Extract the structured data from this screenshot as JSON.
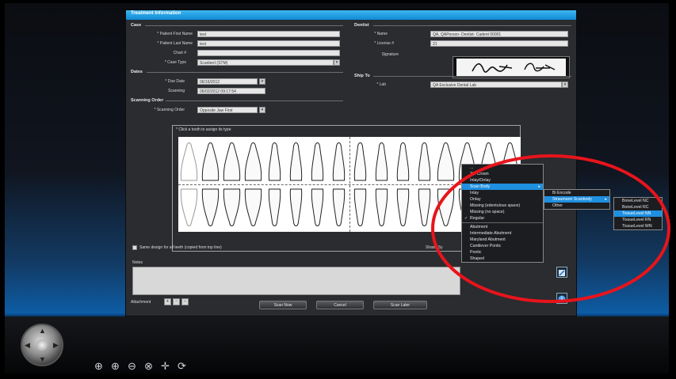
{
  "window": {
    "title": "Treatment Information"
  },
  "case": {
    "section": "Case",
    "first_name_label": "* Patient First Name",
    "first_name_value": "test",
    "last_name_label": "* Patient Last Name",
    "last_name_value": "test",
    "chart_label": "Chart #",
    "chart_value": "",
    "case_type_label": "* Case Type",
    "case_type_value": "Scanbert (STM)"
  },
  "dates": {
    "section": "Dates",
    "due_label": "* Due Date",
    "due_value": "06/16/2012",
    "scanning_label": "Scanning",
    "scanning_value": "06/02/2012 09:17:54"
  },
  "scanning_order": {
    "section": "Scanning Order",
    "label": "* Scanning Order",
    "value": "Opposite Jaw First"
  },
  "dentist": {
    "section": "Dentist",
    "name_label": "* Name",
    "name_value": "QA, QAPerson- Dentist- Cadent 00001",
    "license_label": "* License #",
    "license_value": "21",
    "signature_label": "Signature"
  },
  "ship_to": {
    "section": "Ship To",
    "lab_label": "* Lab",
    "lab_value": "QA Exclusive Dental Lab"
  },
  "teeth": {
    "hint": "* Click a tooth to assign its type",
    "same_design_label": "Same design for all teeth (copied from top line)",
    "shade_label": "Shade Sy"
  },
  "notes": {
    "label": "Notes"
  },
  "attachments": {
    "label": "Attachment"
  },
  "buttons": {
    "scan_now": "Scan Now",
    "cancel": "Cancel",
    "scan_later": "Scan Later"
  },
  "context_menu": {
    "items": [
      "...",
      "3/4 Crown",
      "Inlay/Onlay",
      "Scan Body",
      "Inlay",
      "Onlay",
      "Missing (edentulous space)",
      "Missing (no space)",
      "Regular",
      "Abutment",
      "Intermediate Abutment",
      "Maryland Abutment",
      "Cantilever Pontic",
      "Pontic",
      "Shaped"
    ],
    "submenu1": [
      "Bi Encode",
      "Straumann Scanbody",
      "Other"
    ],
    "submenu2": [
      "BoneLevel NC",
      "BoneLevel RC",
      "TissueLevel NN",
      "TissueLevel RN",
      "TissueLevel WN"
    ]
  },
  "toolbar": {
    "icons": [
      "zoom-in-icon",
      "zoom-in-icon",
      "zoom-out-icon",
      "zoom-fit-icon",
      "move-icon",
      "rotate-icon"
    ]
  },
  "colors": {
    "accent": "#1f8fe0",
    "annotation_circle": "#e8141b",
    "titlebar": "#2aa7ea"
  }
}
